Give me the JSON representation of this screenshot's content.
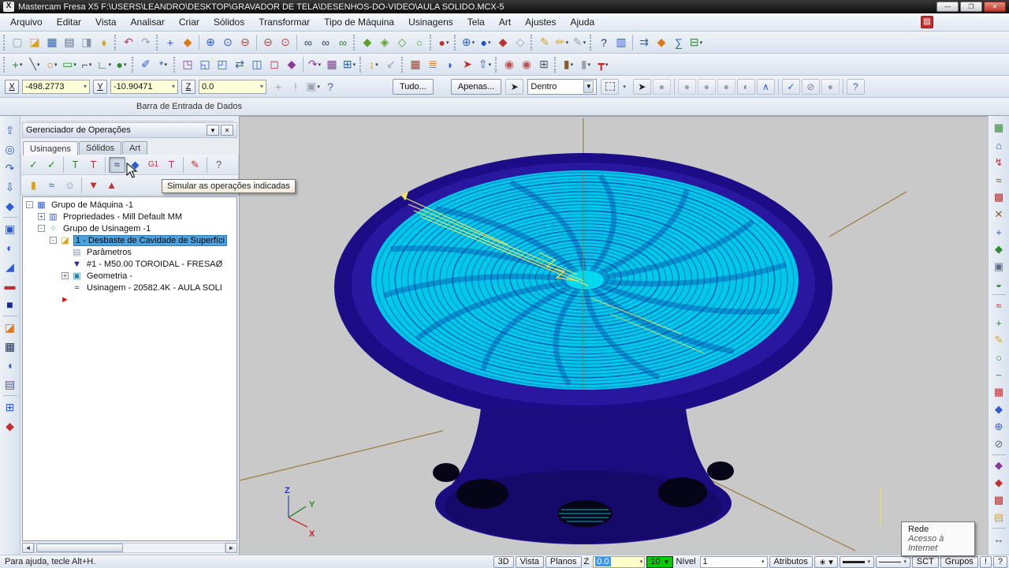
{
  "window": {
    "title": "Mastercam Fresa X5  F:\\USERS\\LEANDRO\\DESKTOP\\GRAVADOR DE TELA\\DESENHOS-DO-VIDEO\\AULA SOLIDO.MCX-5",
    "app_icon_glyph": "X",
    "buttons": {
      "minimize": "—",
      "restore": "❐",
      "close": "✕"
    }
  },
  "menu": {
    "items": [
      "Arquivo",
      "Editar",
      "Vista",
      "Analisar",
      "Criar",
      "Sólidos",
      "Transformar",
      "Tipo de Máquina",
      "Usinagens",
      "Tela",
      "Art",
      "Ajustes",
      "Ajuda"
    ]
  },
  "toolbar_row1": [
    {
      "grip": true
    },
    {
      "n": "new-file-icon",
      "g": "▢",
      "c": "#8a97ad"
    },
    {
      "n": "open-file-icon",
      "g": "◪",
      "c": "#d9a520"
    },
    {
      "n": "save-icon",
      "g": "▦",
      "c": "#2d5bd0"
    },
    {
      "n": "print-icon",
      "g": "▤",
      "c": "#5a6a80"
    },
    {
      "n": "print-preview-icon",
      "g": "◨",
      "c": "#8a97ad"
    },
    {
      "n": "converter-icon",
      "g": "♦",
      "c": "#d9a520"
    },
    {
      "grip": true
    },
    {
      "n": "undo-icon",
      "g": "↶",
      "c": "#c03060"
    },
    {
      "n": "redo-icon",
      "g": "↷",
      "c": "#9aa4b0"
    },
    {
      "grip": true
    },
    {
      "n": "pan-icon",
      "g": "+",
      "c": "#2d5bd0"
    },
    {
      "n": "dynamic-rotate-icon",
      "g": "◆",
      "c": "#e07818"
    },
    {
      "sep": true
    },
    {
      "n": "zoom-in-icon",
      "g": "⊕",
      "c": "#2d5bd0"
    },
    {
      "n": "zoom-window-icon",
      "g": "⊙",
      "c": "#2d5bd0"
    },
    {
      "n": "zoom-out-icon",
      "g": "⊖",
      "c": "#c04040"
    },
    {
      "sep": true
    },
    {
      "n": "zoom-target-icon",
      "g": "⊖",
      "c": "#c04040"
    },
    {
      "n": "zoom-previous-icon",
      "g": "⊙",
      "c": "#c04040"
    },
    {
      "sep": true
    },
    {
      "n": "binoculars-icon",
      "g": "∞",
      "c": "#2d3a60"
    },
    {
      "n": "binoculars-2-icon",
      "g": "∞",
      "c": "#2d3a60"
    },
    {
      "n": "binoculars-check-icon",
      "g": "∞",
      "c": "#2d8a2d"
    },
    {
      "grip": true
    },
    {
      "n": "shade-solid-icon",
      "g": "◆",
      "c": "#5aa02a"
    },
    {
      "n": "shade-edges-icon",
      "g": "◈",
      "c": "#5aa02a"
    },
    {
      "n": "shade-translucent-icon",
      "g": "◇",
      "c": "#5aa02a"
    },
    {
      "n": "shade-wireframe-icon",
      "g": "○",
      "c": "#5aa02a"
    },
    {
      "grip": true
    },
    {
      "n": "material-icon",
      "g": "●",
      "c": "#c03030",
      "dd": true
    },
    {
      "grip": true
    },
    {
      "n": "gview-wireframe-icon",
      "g": "⊕",
      "c": "#2d5bd0",
      "dd": true
    },
    {
      "n": "gview-shaded-icon",
      "g": "●",
      "c": "#1a50c8",
      "dd": true
    },
    {
      "n": "solid-red-icon",
      "g": "◆",
      "c": "#c03030"
    },
    {
      "n": "solid-ghost-icon",
      "g": "◇",
      "c": "#9aa4b0"
    },
    {
      "grip": true
    },
    {
      "n": "pencil-icon",
      "g": "✎",
      "c": "#d9a520"
    },
    {
      "n": "pencil-multi-icon",
      "g": "✏",
      "c": "#d9a520",
      "dd": true
    },
    {
      "n": "pencil-gray-icon",
      "g": "✎",
      "c": "#9aa4b0",
      "dd": true
    },
    {
      "grip": true
    },
    {
      "n": "analyze-entity-icon",
      "g": "?",
      "c": "#2d3a60"
    },
    {
      "n": "analyze-stats-icon",
      "g": "▥",
      "c": "#2d5bd0"
    },
    {
      "sep": true
    },
    {
      "n": "analyze-chain-icon",
      "g": "⇉",
      "c": "#2d5bd0"
    },
    {
      "n": "analyze-solid-icon",
      "g": "◆",
      "c": "#e07818"
    },
    {
      "n": "analyze-sum-icon",
      "g": "∑",
      "c": "#2d5bd0"
    },
    {
      "n": "report-icon",
      "g": "⊟",
      "c": "#2d8a2d",
      "dd": true
    }
  ],
  "toolbar_row2": [
    {
      "grip": true
    },
    {
      "n": "create-point-icon",
      "g": "+",
      "c": "#2d8a2d",
      "dd": true
    },
    {
      "n": "create-line-icon",
      "g": "╲",
      "c": "#556",
      "dd": true
    },
    {
      "n": "create-arc-icon",
      "g": "○",
      "c": "#e07818",
      "dd": true
    },
    {
      "n": "create-rect-icon",
      "g": "▭",
      "c": "#2d8a2d",
      "dd": true
    },
    {
      "n": "create-fillet-icon",
      "g": "⌐",
      "c": "#556",
      "dd": true
    },
    {
      "n": "create-polyline-icon",
      "g": "∟",
      "c": "#2d8a2d",
      "dd": true
    },
    {
      "n": "create-primitive-icon",
      "g": "●",
      "c": "#2d8a2d",
      "dd": true
    },
    {
      "grip": true
    },
    {
      "n": "spray-icon",
      "g": "✐",
      "c": "#2d5bd0"
    },
    {
      "n": "pattern-icon",
      "g": "*",
      "c": "#2d5bd0",
      "dd": true
    },
    {
      "grip": true
    },
    {
      "n": "xform-translate-icon",
      "g": "◳",
      "c": "#8a3a9a"
    },
    {
      "n": "xform-copy-icon",
      "g": "◱",
      "c": "#2d5bd0"
    },
    {
      "n": "xform-move-icon",
      "g": "◰",
      "c": "#2d5bd0"
    },
    {
      "n": "xform-mirror-icon",
      "g": "⇄",
      "c": "#2d5bd0"
    },
    {
      "n": "xform-offset-icon",
      "g": "◫",
      "c": "#2d5bd0"
    },
    {
      "n": "xform-scale-icon",
      "g": "◻",
      "c": "#c03030"
    },
    {
      "n": "xform-project-icon",
      "g": "◆",
      "c": "#8a3a9a"
    },
    {
      "sep": true
    },
    {
      "n": "xform-rotate-icon",
      "g": "↷",
      "c": "#8a3a9a",
      "dd": true
    },
    {
      "n": "xform-array-icon",
      "g": "▦",
      "c": "#8a3a9a"
    },
    {
      "n": "xform-nest-icon",
      "g": "⊞",
      "c": "#2d5bd0",
      "dd": true
    },
    {
      "grip": true
    },
    {
      "n": "shade-settings-icon",
      "g": "↕",
      "c": "#d9a520",
      "dd": true
    },
    {
      "n": "shrink-icon",
      "g": "↙",
      "c": "#9aa4b0"
    },
    {
      "grip": true
    },
    {
      "n": "grid-red-icon",
      "g": "▦",
      "c": "#c03030"
    },
    {
      "n": "levels-lines-icon",
      "g": "≣",
      "c": "#e07818"
    },
    {
      "n": "sail-icon",
      "g": "◗",
      "c": "#2d5bd0"
    },
    {
      "n": "rocket-icon",
      "g": "➤",
      "c": "#c03030"
    },
    {
      "n": "box-up-icon",
      "g": "⇧",
      "c": "#2d5bd0",
      "dd": true
    },
    {
      "grip": true
    },
    {
      "n": "flower-1-icon",
      "g": "◉",
      "c": "#c05050"
    },
    {
      "n": "flower-2-icon",
      "g": "◉",
      "c": "#c05050"
    },
    {
      "n": "wire-cube-icon",
      "g": "⊞",
      "c": "#556"
    },
    {
      "grip": true
    },
    {
      "n": "stock-icon",
      "g": "▮",
      "c": "#8a5a2a",
      "dd": true
    },
    {
      "n": "stock-gray-icon",
      "g": "▮",
      "c": "#9aa4b0",
      "dd": true
    },
    {
      "n": "tool-pin-icon",
      "g": "┳",
      "c": "#c03030",
      "dd": true
    }
  ],
  "coordbar": {
    "x_label": "X",
    "x_value": "-498.2773",
    "y_label": "Y",
    "y_value": "-10.90471",
    "z_label": "Z",
    "z_value": "0.0",
    "gray_icons": [
      {
        "n": "fast-point-icon",
        "g": "+",
        "c": "#9aa4b0"
      },
      {
        "n": "important-icon",
        "g": "!",
        "c": "#9aa4b0"
      },
      {
        "n": "fist-icon",
        "g": "▣",
        "c": "#9aa4b0",
        "dd": true
      },
      {
        "n": "help-icon",
        "g": "?",
        "c": "#445a9a"
      }
    ],
    "btn_tudo": "Tudo...",
    "btn_apenas": "Apenas...",
    "dentro_value": "Dentro",
    "circle_buttons": [
      {
        "n": "select-cursor-icon",
        "g": "➤",
        "c": "#222",
        "en": true
      },
      {
        "n": "select-disabled-1-icon",
        "g": "●",
        "c": "#9aa4b0",
        "en": false
      },
      {
        "sep": true
      },
      {
        "n": "select-disabled-2-icon",
        "g": "●",
        "c": "#9aa4b0",
        "en": false
      },
      {
        "n": "select-disabled-3-icon",
        "g": "●",
        "c": "#9aa4b0",
        "en": false
      },
      {
        "n": "select-disabled-4-icon",
        "g": "●",
        "c": "#9aa4b0",
        "en": false
      },
      {
        "n": "select-solid-icon",
        "g": "◐",
        "c": "#788494",
        "en": true
      },
      {
        "n": "select-last-icon",
        "g": "∧",
        "c": "#2d5bd0",
        "en": true
      },
      {
        "sep": true
      },
      {
        "n": "select-validate-icon",
        "g": "✓",
        "c": "#2d5bd0",
        "en": true
      },
      {
        "n": "select-none-icon",
        "g": "⊘",
        "c": "#788494",
        "en": true
      },
      {
        "n": "select-disabled-5-icon",
        "g": "●",
        "c": "#9aa4b0",
        "en": false
      },
      {
        "sep": true
      },
      {
        "n": "select-help-icon",
        "g": "?",
        "c": "#445a9a",
        "en": true
      }
    ]
  },
  "databar": {
    "label": "Barra de Entrada de Dados"
  },
  "left_toolbar": [
    {
      "n": "solid-extrude-icon",
      "g": "⇧",
      "c": "#2d5bd0"
    },
    {
      "n": "solid-revolve-icon",
      "g": "◎",
      "c": "#2d5bd0"
    },
    {
      "n": "solid-sweep-icon",
      "g": "↷",
      "c": "#2d5bd0"
    },
    {
      "n": "solid-loft-icon",
      "g": "⇩",
      "c": "#2d5bd0"
    },
    {
      "n": "solid-fillet-icon",
      "g": "◆",
      "c": "#2d5bd0"
    },
    {
      "sep": true
    },
    {
      "n": "solid-shell-icon",
      "g": "▣",
      "c": "#2d5bd0"
    },
    {
      "n": "solid-boolean-icon",
      "g": "◐",
      "c": "#2d5bd0"
    },
    {
      "n": "solid-chamfer-icon",
      "g": "◢",
      "c": "#2d5bd0"
    },
    {
      "n": "solid-trim-icon",
      "g": "▬",
      "c": "#c03030"
    },
    {
      "n": "solid-block-icon",
      "g": "■",
      "c": "#1a2a90"
    },
    {
      "sep": true
    },
    {
      "n": "solid-draft-icon",
      "g": "◪",
      "c": "#e07818"
    },
    {
      "n": "solid-mesh-icon",
      "g": "▦",
      "c": "#1a2a90"
    },
    {
      "n": "solid-thicken-icon",
      "g": "◖",
      "c": "#2d5bd0"
    },
    {
      "n": "solid-history-icon",
      "g": "▤",
      "c": "#2d5bd0"
    },
    {
      "sep": true
    },
    {
      "n": "solid-layout-icon",
      "g": "⊞",
      "c": "#2d5bd0"
    },
    {
      "n": "solid-primitives-icon",
      "g": "◆",
      "c": "#c03030"
    }
  ],
  "right_toolbar": [
    {
      "n": "view-fit-icon",
      "g": "▦",
      "c": "#2d8a2d"
    },
    {
      "n": "view-home-icon",
      "g": "⌂",
      "c": "#2d5bd0"
    },
    {
      "n": "view-branch-icon",
      "g": "↯",
      "c": "#c03030"
    },
    {
      "n": "view-rotate-icon",
      "g": "≈",
      "c": "#c03030"
    },
    {
      "n": "view-colors-icon",
      "g": "▩",
      "c": "#c03030"
    },
    {
      "n": "view-sticks-icon",
      "g": "✕",
      "c": "#8a5a2a"
    },
    {
      "n": "view-pan-icon",
      "g": "+",
      "c": "#2d5bd0"
    },
    {
      "n": "view-iso-icon",
      "g": "◆",
      "c": "#2d8a2d"
    },
    {
      "n": "view-camera-icon",
      "g": "▣",
      "c": "#5a6a80"
    },
    {
      "n": "view-section-icon",
      "g": "◒",
      "c": "#2d8a2d"
    },
    {
      "sep": true
    },
    {
      "n": "view-rotate2-icon",
      "g": "≈",
      "c": "#c03030"
    },
    {
      "n": "view-add-icon",
      "g": "+",
      "c": "#2d8a2d"
    },
    {
      "n": "edit-pencil-icon",
      "g": "✎",
      "c": "#d9a520"
    },
    {
      "n": "edit-circle-icon",
      "g": "○",
      "c": "#2d8a2d"
    },
    {
      "n": "edit-curve-icon",
      "g": "~",
      "c": "#2d8a2d"
    },
    {
      "n": "edit-grid-icon",
      "g": "▦",
      "c": "#c03030"
    },
    {
      "n": "edit-cube-icon",
      "g": "◆",
      "c": "#2d5bd0"
    },
    {
      "n": "edit-globe-icon",
      "g": "⊕",
      "c": "#2d5bd0"
    },
    {
      "n": "edit-none-icon",
      "g": "⊘",
      "c": "#667"
    },
    {
      "sep": true
    },
    {
      "n": "edit-purple-icon",
      "g": "◆",
      "c": "#8a3a9a"
    },
    {
      "n": "edit-red-icon",
      "g": "◆",
      "c": "#c03030"
    },
    {
      "n": "edit-multigrid-icon",
      "g": "▩",
      "c": "#c03030"
    },
    {
      "n": "edit-image-icon",
      "g": "▤",
      "c": "#d9a520"
    },
    {
      "sep": true
    },
    {
      "n": "measure-icon",
      "g": "↔",
      "c": "#556"
    }
  ],
  "panel": {
    "title": "Gerenciador de Operações",
    "collapse_glyph": "▼",
    "close_glyph": "✕",
    "tabs": [
      {
        "label": "Usinagens",
        "active": true
      },
      {
        "label": "Sólidos",
        "active": false
      },
      {
        "label": "Art",
        "active": false
      }
    ],
    "toolbar1": [
      {
        "n": "select-all-ops-icon",
        "g": "✓",
        "c": "#1a9a1a"
      },
      {
        "n": "unselect-all-ops-icon",
        "g": "✓",
        "c": "#1a9a1a"
      },
      {
        "sep": true
      },
      {
        "n": "regen-ops-icon",
        "g": "T",
        "c": "#2d8a2d"
      },
      {
        "n": "regen-dirty-icon",
        "g": "T",
        "c": "#c03030"
      },
      {
        "sep": true
      },
      {
        "n": "simulate-ops-icon",
        "g": "≈",
        "c": "#2d3a60",
        "pressed": true
      },
      {
        "n": "verify-icon",
        "g": "◆",
        "c": "#2d5bd0"
      },
      {
        "n": "g1-icon",
        "g": "G1",
        "c": "#c03030"
      },
      {
        "n": "post-icon",
        "g": "T",
        "c": "#c03060"
      },
      {
        "sep": true
      },
      {
        "n": "feed-icon",
        "g": "✎",
        "c": "#c03030"
      },
      {
        "sep": true
      },
      {
        "n": "ops-help-icon",
        "g": "?",
        "c": "#556"
      }
    ],
    "toolbar2": [
      {
        "n": "lock-icon",
        "g": "▮",
        "c": "#d9a520"
      },
      {
        "n": "toggle-toolpath-icon",
        "g": "≈",
        "c": "#2d5bd0"
      },
      {
        "n": "ghost-icon",
        "g": "☺",
        "c": "#8a97ad"
      },
      {
        "sep": true
      },
      {
        "n": "move-down-icon",
        "g": "▼",
        "c": "#c03030"
      },
      {
        "n": "move-up-icon",
        "g": "▲",
        "c": "#c03030"
      }
    ],
    "tree": [
      {
        "indent": 0,
        "exp": "-",
        "g": "▦",
        "c": "#2d5bd0",
        "label": "Grupo de Máquina -1"
      },
      {
        "indent": 1,
        "exp": "+",
        "g": "▥",
        "c": "#2d5bd0",
        "label": "Propriedades - Mill Default MM"
      },
      {
        "indent": 1,
        "exp": "-",
        "g": "⁘",
        "c": "#1a8ab0",
        "label": "Grupo de Usinagem -1"
      },
      {
        "indent": 2,
        "exp": "-",
        "g": "◪",
        "c": "#d9a520",
        "label": "1 - Desbaste de Cavidade de Superfíci",
        "selected": true
      },
      {
        "indent": 3,
        "exp": null,
        "g": "▤",
        "c": "#8a97ad",
        "label": "Parâmetros"
      },
      {
        "indent": 3,
        "exp": null,
        "g": "▼",
        "c": "#1a2a90",
        "label": "#1 - M50.00 TOROIDAL - FRESAØ"
      },
      {
        "indent": 3,
        "exp": "+",
        "g": "▣",
        "c": "#1a8ab0",
        "label": "Geometria -"
      },
      {
        "indent": 3,
        "exp": null,
        "g": "≈",
        "c": "#1a2a90",
        "label": "Usinagem - 20582.4K - AULA SOLI"
      },
      {
        "indent": 2,
        "exp": null,
        "g": "►",
        "c": "#e01010",
        "label": ""
      }
    ]
  },
  "tooltips": {
    "simulate": "Simular as operações indicadas",
    "rede_title": "Rede",
    "rede_subtitle": "Acesso à Internet"
  },
  "viewport": {
    "gnomon": {
      "z": "Z",
      "y": "Y",
      "x": "X"
    }
  },
  "statusbar": {
    "left": "Para ajuda, tecle Alt+H.",
    "right": [
      {
        "t": "btn",
        "x": "3D",
        "n": "status-3d-button"
      },
      {
        "t": "btn",
        "x": "Vista",
        "n": "status-vista-button"
      },
      {
        "t": "btn",
        "x": "Planos",
        "n": "status-planos-button"
      },
      {
        "t": "lbl",
        "x": "Z",
        "n": "status-z-label"
      },
      {
        "t": "zfield",
        "x": "0.0",
        "n": "status-z-field"
      },
      {
        "t": "green",
        "x": "10",
        "n": "status-linewidth-button"
      },
      {
        "t": "lbl",
        "x": "Nível",
        "n": "status-nivel-label"
      },
      {
        "t": "select",
        "x": "1",
        "n": "status-nivel-select"
      },
      {
        "t": "btn",
        "x": "Atributos",
        "n": "status-atributos-button"
      },
      {
        "t": "btn",
        "x": "∗ ▾",
        "n": "status-pointstyle-button"
      },
      {
        "t": "line",
        "w": 3,
        "n": "status-linestyle-button"
      },
      {
        "t": "line",
        "w": 1,
        "n": "status-linestyle2-button"
      },
      {
        "t": "btn",
        "x": "SCT",
        "n": "status-sct-button"
      },
      {
        "t": "btn",
        "x": "Grupos",
        "n": "status-grupos-button"
      },
      {
        "t": "btn",
        "x": "!",
        "n": "status-alert-button"
      },
      {
        "t": "btn",
        "x": "?",
        "n": "status-help-button"
      }
    ]
  },
  "colors": {
    "bowl_rim": "#1c0d86",
    "bowl_inner": "#2a17a0",
    "toolpath_cyan": "#00c8e8",
    "toolpath_dark": "#0a3ea8",
    "toolpath_yellow": "#e8e460",
    "axis_tan": "#9a7a40",
    "viewport_bg": "#c9c9c9",
    "selection_blue": "#49a3e0"
  }
}
